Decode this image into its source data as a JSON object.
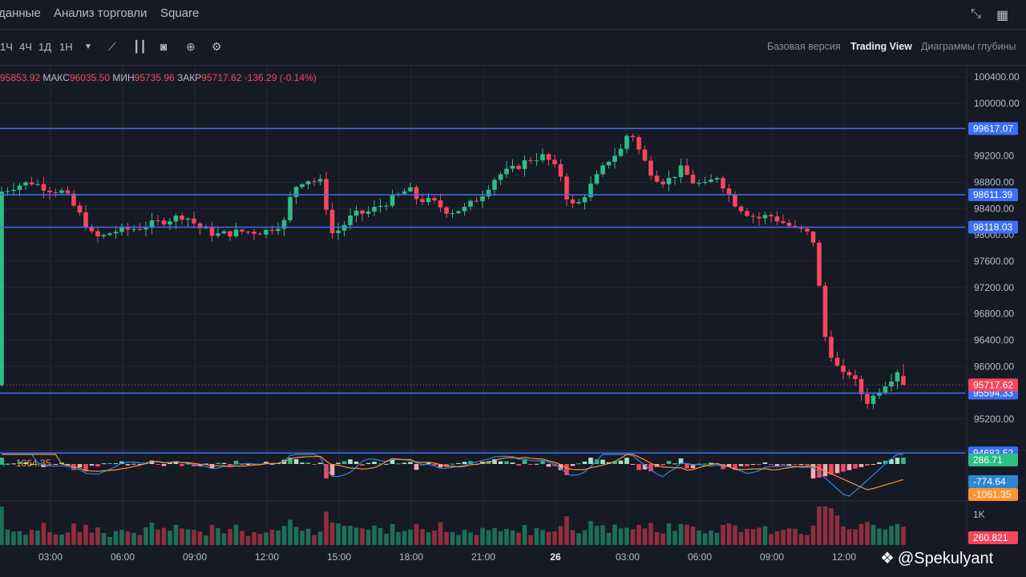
{
  "nav": {
    "tabs": [
      "данные",
      "Анализ торговли",
      "Square"
    ],
    "expand_icon": "expand-icon",
    "grid_icon": "grid-icon"
  },
  "toolbar": {
    "timeframes": [
      "1Ч",
      "4Ч",
      "1Д",
      "1Н"
    ],
    "icons": [
      "dropdown-icon",
      "indicator-icon",
      "candle-type-icon",
      "camera-icon",
      "add-icon",
      "settings-icon"
    ],
    "views": [
      "Базовая версия",
      "Trading View",
      "Диаграммы глубины"
    ],
    "active_view": "Trading View"
  },
  "ohlc": {
    "open": "95853.92",
    "high_label": "МАКС",
    "high": "96035.50",
    "low_label": "МИН",
    "low": "95735.96",
    "close_label": "ЗАКР",
    "close": "95717.62",
    "change": "-136.29 (-0.14%)"
  },
  "chart_data": {
    "type": "candlestick",
    "price_axis": [
      "100400.00",
      "100000.00",
      "99200.00",
      "98800.00",
      "98400.00",
      "97600.00",
      "97200.00",
      "96800.00",
      "96400.00",
      "96000.00",
      "95200.00"
    ],
    "price_range": [
      94850,
      100450
    ],
    "time_axis": [
      "03:00",
      "06:00",
      "09:00",
      "12:00",
      "15:00",
      "18:00",
      "21:00",
      "26",
      "03:00",
      "06:00",
      "09:00",
      "12:00"
    ],
    "hlines": [
      {
        "price": 99617.07,
        "label": "99617.07"
      },
      {
        "price": 98611.39,
        "label": "98611.39"
      },
      {
        "price": 98118.03,
        "label": "98118.03"
      },
      {
        "price": 95594.33,
        "label": "95594.33"
      },
      {
        "price": 94683.52,
        "label": "94683.52"
      }
    ],
    "last_price": {
      "price": 95717.62,
      "label": "95717.62"
    },
    "macd": {
      "label_left": "-1064.35",
      "histogram_label": "286.71",
      "macd_label": "-774.64",
      "signal_label": "-1061.35"
    },
    "volume": {
      "axis_label": "1K",
      "last_label": "260.821"
    },
    "colors": {
      "up": "#2ebd85",
      "down": "#f6465d",
      "hline": "#3b6ff5",
      "bg": "#161a25",
      "grid": "#232733"
    }
  },
  "watermark": "@Spekulyant",
  "watermark_icon": "binance-logo-icon"
}
